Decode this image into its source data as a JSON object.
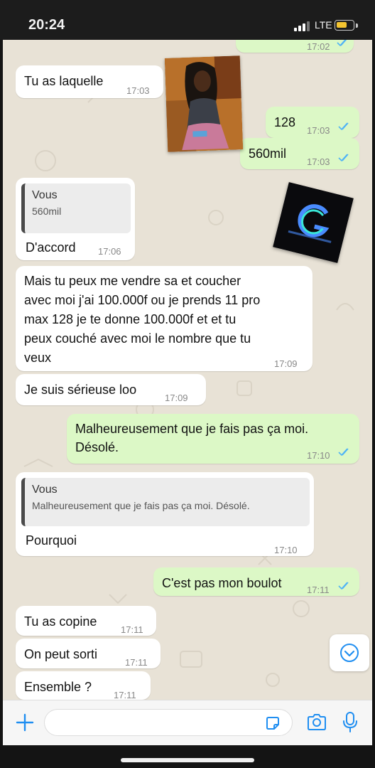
{
  "status_bar": {
    "time": "20:24",
    "network": "LTE",
    "battery_color": "#f4c430"
  },
  "colors": {
    "incoming_bubble": "#ffffff",
    "outgoing_bubble": "#dcf8c6",
    "read_ticks": "#4fb3f6",
    "chat_background": "#e8e2d6",
    "icon_blue": "#1f8ef1"
  },
  "messages": [
    {
      "direction": "outgoing",
      "text": "",
      "time": "17:02",
      "status": "read"
    },
    {
      "direction": "incoming",
      "text": "Tu as laquelle",
      "time": "17:03"
    },
    {
      "direction": "outgoing",
      "text": "128",
      "time": "17:03",
      "status": "read"
    },
    {
      "direction": "outgoing",
      "text": "560mil",
      "time": "17:03",
      "status": "read"
    },
    {
      "direction": "incoming",
      "quote_name": "Vous",
      "quote_text": "560mil",
      "text": "D'accord",
      "time": "17:06"
    },
    {
      "direction": "incoming",
      "lines": [
        "Mais tu peux me vendre sa et coucher",
        "avec moi j'ai 100.000f ou je prends 11 pro",
        "max 128 je te donne 100.000f et et tu",
        "peux couché avec moi le nombre que tu",
        "veux"
      ],
      "time": "17:09"
    },
    {
      "direction": "incoming",
      "text": "Je suis sérieuse loo",
      "time": "17:09"
    },
    {
      "direction": "outgoing",
      "lines": [
        "Malheureusement que je fais pas ça moi.",
        "Désolé."
      ],
      "time": "17:10",
      "status": "read"
    },
    {
      "direction": "incoming",
      "quote_name": "Vous",
      "quote_text": "Malheureusement que je fais pas ça moi. Désolé.",
      "text": "Pourquoi",
      "time": "17:10"
    },
    {
      "direction": "outgoing",
      "text": "C'est pas mon boulot",
      "time": "17:11",
      "status": "read"
    },
    {
      "direction": "incoming",
      "text": "Tu as copine",
      "time": "17:11"
    },
    {
      "direction": "incoming",
      "text": "On peut sorti",
      "time": "17:11"
    },
    {
      "direction": "incoming",
      "text": "Ensemble ?",
      "time": "17:11"
    }
  ],
  "overlays": {
    "photo": "profile-photo",
    "logo": "watermark-logo"
  },
  "input_bar": {
    "placeholder": "",
    "icons": [
      "plus-icon",
      "sticker-icon",
      "camera-icon",
      "microphone-icon"
    ]
  },
  "scroll_button_icon": "chevron-down-circle-icon"
}
